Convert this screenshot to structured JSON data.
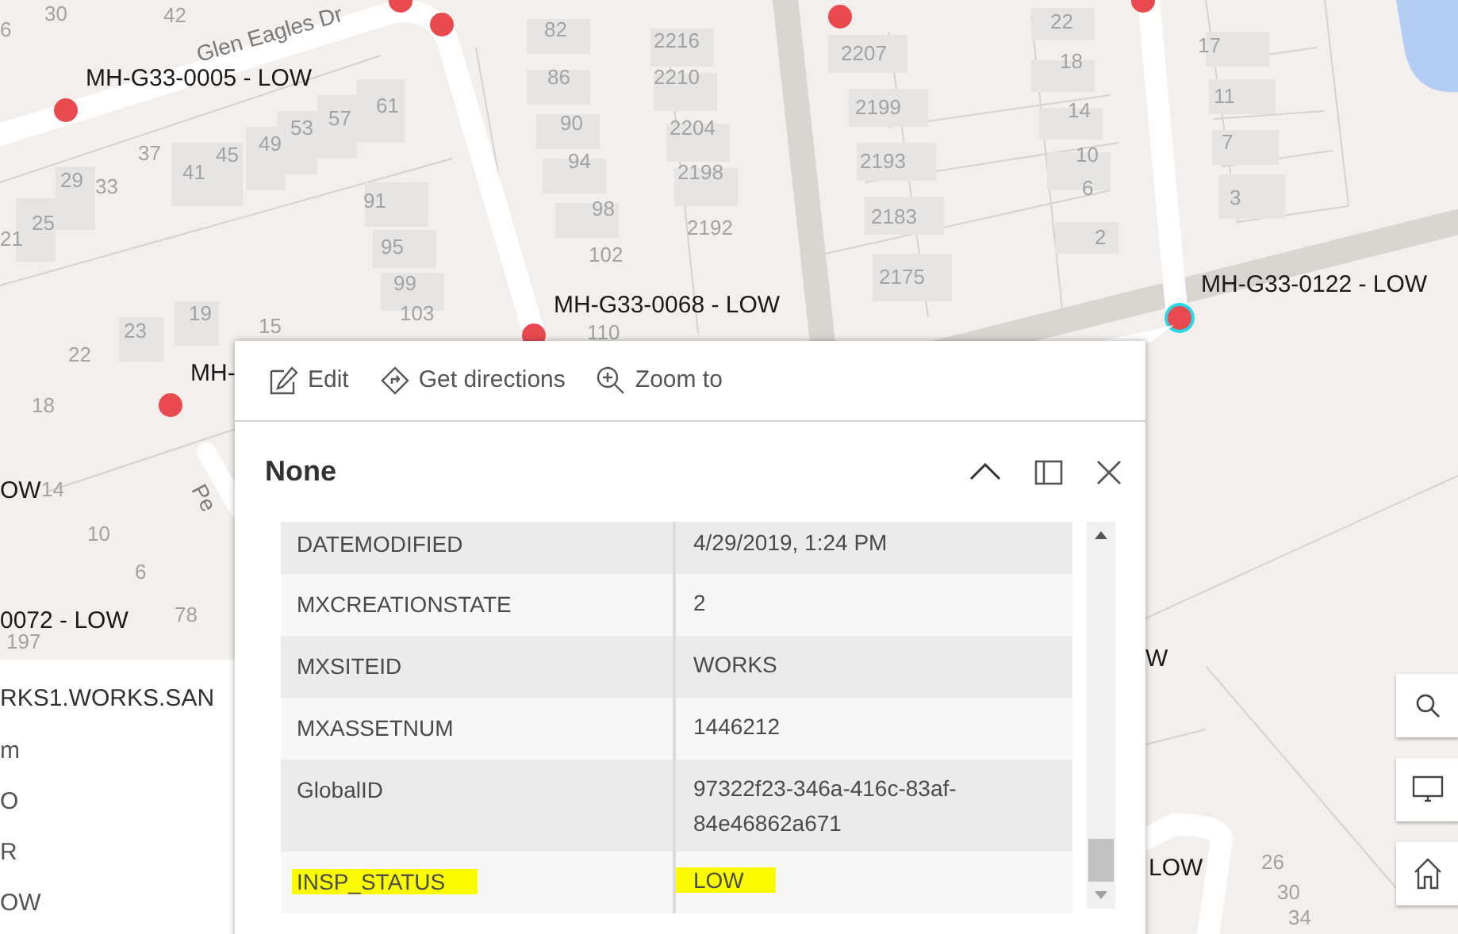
{
  "map": {
    "street_labels": [
      "Glen Eagles Dr",
      "Pe"
    ],
    "manhole_labels": [
      "MH-G33-0005 - LOW",
      "MH-G33-0068 - LOW",
      "MH-G33-0122 - LOW",
      "MH-",
      "OW",
      "0072 - LOW",
      "W",
      "LOW"
    ],
    "house_numbers": [
      "30",
      "42",
      "6",
      "82",
      "2216",
      "86",
      "2210",
      "90",
      "2204",
      "61",
      "57",
      "53",
      "49",
      "45",
      "41",
      "37",
      "29",
      "33",
      "25",
      "21",
      "94",
      "2198",
      "91",
      "98",
      "2192",
      "95",
      "102",
      "99",
      "103",
      "110",
      "19",
      "23",
      "15",
      "22",
      "18",
      "14",
      "10",
      "6",
      "78",
      "197",
      "2207",
      "22",
      "18",
      "2199",
      "14",
      "17",
      "11",
      "2193",
      "10",
      "7",
      "6",
      "2183",
      "3",
      "2",
      "2175",
      "26",
      "30",
      "34"
    ],
    "manholes": [
      {
        "selected": false
      },
      {
        "selected": false
      },
      {
        "selected": false
      },
      {
        "selected": false
      },
      {
        "selected": false
      },
      {
        "selected": false
      },
      {
        "selected": false
      },
      {
        "selected": true
      }
    ]
  },
  "popup": {
    "actions": [
      {
        "kind": "edit",
        "label": "Edit"
      },
      {
        "kind": "directions",
        "label": "Get directions"
      },
      {
        "kind": "zoom",
        "label": "Zoom to"
      }
    ],
    "title": "None",
    "fields": [
      {
        "name": "DATEMODIFIED",
        "value": "4/29/2019, 1:24 PM",
        "highlighted": false
      },
      {
        "name": "MXCREATIONSTATE",
        "value": "2",
        "highlighted": false
      },
      {
        "name": "MXSITEID",
        "value": "WORKS",
        "highlighted": false
      },
      {
        "name": "MXASSETNUM",
        "value": "1446212",
        "highlighted": false
      },
      {
        "name": "GlobalID",
        "value": "97322f23-346a-416c-83af-84e46862a671",
        "highlighted": false
      },
      {
        "name": "INSP_STATUS",
        "value": "LOW",
        "highlighted": true
      }
    ]
  },
  "side_panel": {
    "title": "RKS1.WORKS.SAN",
    "lines": [
      "m",
      "O",
      "R",
      "OW"
    ]
  }
}
